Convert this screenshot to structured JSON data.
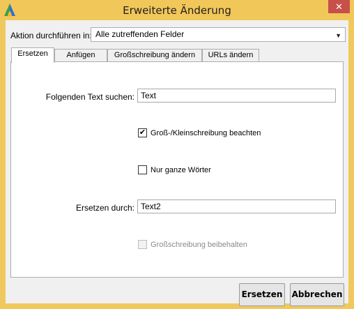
{
  "window": {
    "title": "Erweiterte Änderung",
    "close_glyph": "✕",
    "logo_icon": "app-logo-icon",
    "colors": {
      "titlebar": "#f2c75a",
      "close": "#c7504a"
    }
  },
  "action": {
    "label": "Aktion durchführen in:",
    "selected": "Alle zutreffenden Felder",
    "arrow": "▼"
  },
  "tabs": [
    {
      "label": "Ersetzen",
      "active": true
    },
    {
      "label": "Anfügen",
      "active": false
    },
    {
      "label": "Großschreibung ändern",
      "active": false
    },
    {
      "label": "URLs ändern",
      "active": false
    }
  ],
  "form": {
    "find_label": "Folgenden Text suchen:",
    "find_value": "Text",
    "case_label": "Groß-/Kleinschreibung beachten",
    "case_checked": true,
    "whole_label": "Nur ganze Wörter",
    "whole_checked": false,
    "replace_label": "Ersetzen durch:",
    "replace_value": "Text2",
    "keep_case_label": "Großschreibung beibehalten",
    "keep_case_checked": false,
    "keep_case_disabled": true,
    "check_glyph": "✔"
  },
  "buttons": {
    "replace": "Ersetzen",
    "cancel": "Abbrechen"
  }
}
